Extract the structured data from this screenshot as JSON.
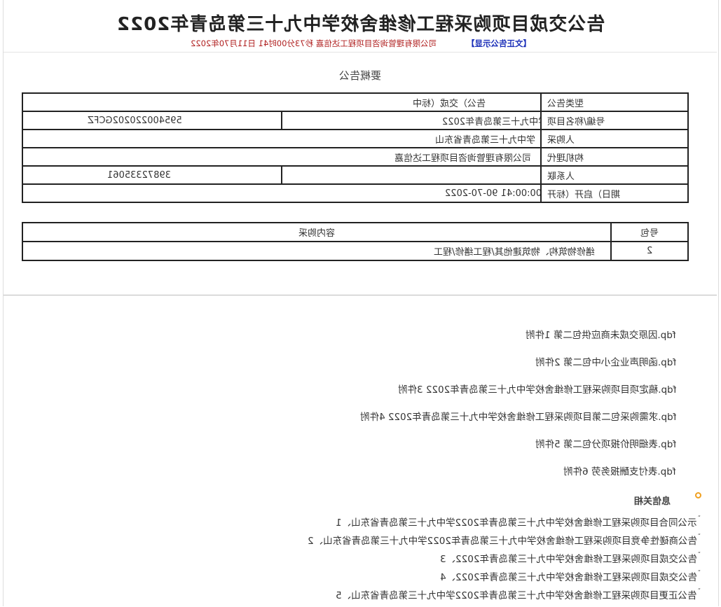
{
  "notice": {
    "title": "告公交成目项购采程工修维舍校学中九十三第岛青年2022",
    "meta": "司公限有理管询咨目项程工达信嘉 秒73分00时41 日11月70年2022",
    "source_link": "【文正告公示显】"
  },
  "summary": {
    "heading": "要概告公",
    "rows": [
      {
        "label": "型类告公",
        "value": "告公）交成（标中",
        "extra": ""
      },
      {
        "label": "号编/称名目项",
        "value": "目项购采程工修维舍校学中九十三第岛青年2022",
        "extra": "595400220202GCFZ"
      },
      {
        "label": "人购采",
        "value": "学中九十三第岛青省东山",
        "extra": ""
      },
      {
        "label": "构机理代",
        "value": "司公限有理管询咨目项程工达信嘉",
        "extra": ""
      },
      {
        "label": "人系联",
        "value": "涛周",
        "extra": "39872335061"
      },
      {
        "label": "期日）启开（标开",
        "value": "00:00:41 90-70-2022",
        "extra": ""
      }
    ]
  },
  "packages": {
    "header_no": "号包",
    "header_content": "容内购采",
    "rows": [
      {
        "no": "2",
        "content": "缮修物筑构、物筑建他其/程工缮修/程工"
      }
    ]
  },
  "attachments": [
    "fdp.因原交成未商应供包二第 1件附",
    "fdp.函明声业企小中包二第 2件附",
    "fdp.稿定项目项购采程工修维舍校学中九十三第岛青年2022 3件附",
    "fdp.求需购采包二第目项购采程工修维舍校学中九十三第岛青年2022 4件附",
    "fdp.表细明价报项分包二第 5件附",
    "fdp.表付支酬报务劳 6件附"
  ],
  "related": {
    "heading": "息信关相",
    "items": [
      "示公同合目项购采程工修维舍校学中九十三第岛青年2022学中九十三第岛青省东山、1",
      "告公商磋性争竞目项购采程工修维舍校学中九十三第岛青年2022学中九十三第岛青省东山、2",
      "告公交成目项购采程工修维舍校学中九十三第岛青年2022、3",
      "告公交成目项购采程工修维舍校学中九十三第岛青年2022、4",
      "告公正更目项购采程工修维舍校学中九十三第岛青年2022学中九十三第岛青省东山、5"
    ]
  },
  "colors": {
    "meta_text": "#b02020",
    "link_text": "#1a2eb8",
    "bullet_ring": "#f0a020"
  }
}
